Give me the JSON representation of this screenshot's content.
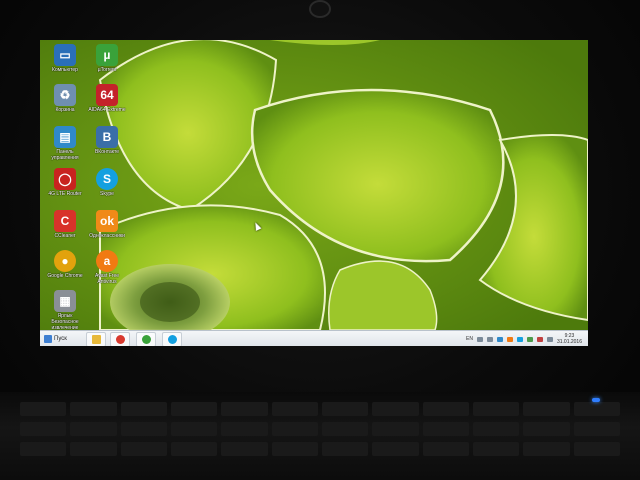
{
  "desktop": {
    "icons": [
      {
        "label": "Компьютер",
        "icon": "computer-icon",
        "color": "#2a6fb8"
      },
      {
        "label": "µTorrent",
        "icon": "utorrent-icon",
        "color": "#3aa23a"
      },
      {
        "label": "Корзина",
        "icon": "recycle-bin-icon",
        "color": "#6f8fb0"
      },
      {
        "label": "AIDA64 Extreme",
        "icon": "aida64-icon",
        "color": "#c4222a"
      },
      {
        "label": "Панель управления",
        "icon": "control-panel-icon",
        "color": "#2f89c9"
      },
      {
        "label": "ВКонтакте",
        "icon": "vk-icon",
        "color": "#3a6ea8"
      },
      {
        "label": "4G LTE Router",
        "icon": "router-icon",
        "color": "#c8231f"
      },
      {
        "label": "Skype",
        "icon": "skype-icon",
        "color": "#14a0e0"
      },
      {
        "label": "CCleaner",
        "icon": "ccleaner-icon",
        "color": "#d8322a"
      },
      {
        "label": "Одноклассники",
        "icon": "odnoklassniki-icon",
        "color": "#f08a18"
      },
      {
        "label": "Google Chrome",
        "icon": "chrome-icon",
        "color": "#e2a20d"
      },
      {
        "label": "Avast Free Antivirus",
        "icon": "avast-icon",
        "color": "#f17a12"
      },
      {
        "label": "Ярлык Безопасное извлечение",
        "icon": "printer-icon",
        "color": "#8a8f96"
      }
    ]
  },
  "taskbar": {
    "start_label": "Пуск",
    "pinned": [
      {
        "icon": "folder-icon",
        "color": "#e7b93a"
      },
      {
        "icon": "chrome-icon",
        "color": "#d83a2e"
      },
      {
        "icon": "utorrent-icon",
        "color": "#3aa23a"
      },
      {
        "icon": "skype-icon",
        "color": "#14a0e0"
      }
    ],
    "tray": {
      "language": "EN",
      "time": "9:23",
      "date": "31.01.2016"
    }
  },
  "colors": {
    "wallpaper_green": "#9cc62a",
    "taskbar_bg": "#e9edf1"
  }
}
